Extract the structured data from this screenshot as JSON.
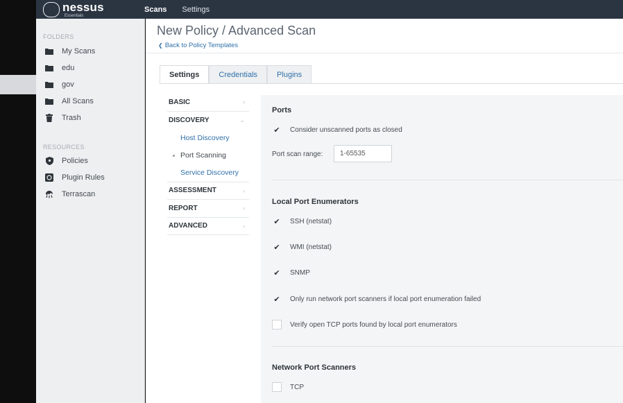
{
  "app": {
    "name": "nessus",
    "edition": "Essentials"
  },
  "nav": {
    "scans": "Scans",
    "settings": "Settings"
  },
  "sidebar": {
    "folders_header": "FOLDERS",
    "folders": [
      {
        "label": "My Scans",
        "icon": "folder-icon"
      },
      {
        "label": "edu",
        "icon": "folder-icon"
      },
      {
        "label": "gov",
        "icon": "folder-icon"
      },
      {
        "label": "All Scans",
        "icon": "folder-icon"
      },
      {
        "label": "Trash",
        "icon": "trash-icon"
      }
    ],
    "resources_header": "RESOURCES",
    "resources": [
      {
        "label": "Policies",
        "icon": "shield-icon"
      },
      {
        "label": "Plugin Rules",
        "icon": "plugin-rules-icon"
      },
      {
        "label": "Terrascan",
        "icon": "terrascan-icon"
      }
    ]
  },
  "page": {
    "title": "New Policy / Advanced Scan",
    "back_link": "Back to Policy Templates"
  },
  "tabs": [
    "Settings",
    "Credentials",
    "Plugins"
  ],
  "settings_nav": {
    "basic": "BASIC",
    "discovery": "DISCOVERY",
    "discovery_items": [
      "Host Discovery",
      "Port Scanning",
      "Service Discovery"
    ],
    "assessment": "ASSESSMENT",
    "report": "REPORT",
    "advanced": "ADVANCED"
  },
  "ports": {
    "title": "Ports",
    "consider_unscanned": "Consider unscanned ports as closed",
    "range_label": "Port scan range:",
    "range_value": "1-65535"
  },
  "local_enum": {
    "title": "Local Port Enumerators",
    "ssh": "SSH (netstat)",
    "wmi": "WMI (netstat)",
    "snmp": "SNMP",
    "only_run": "Only run network port scanners if local port enumeration failed",
    "verify_tcp": "Verify open TCP ports found by local port enumerators"
  },
  "network_scanners": {
    "title": "Network Port Scanners",
    "tcp": "TCP"
  },
  "checks": {
    "consider_unscanned": true,
    "ssh": true,
    "wmi": true,
    "snmp": true,
    "only_run": true,
    "verify_tcp": false,
    "tcp": false
  }
}
